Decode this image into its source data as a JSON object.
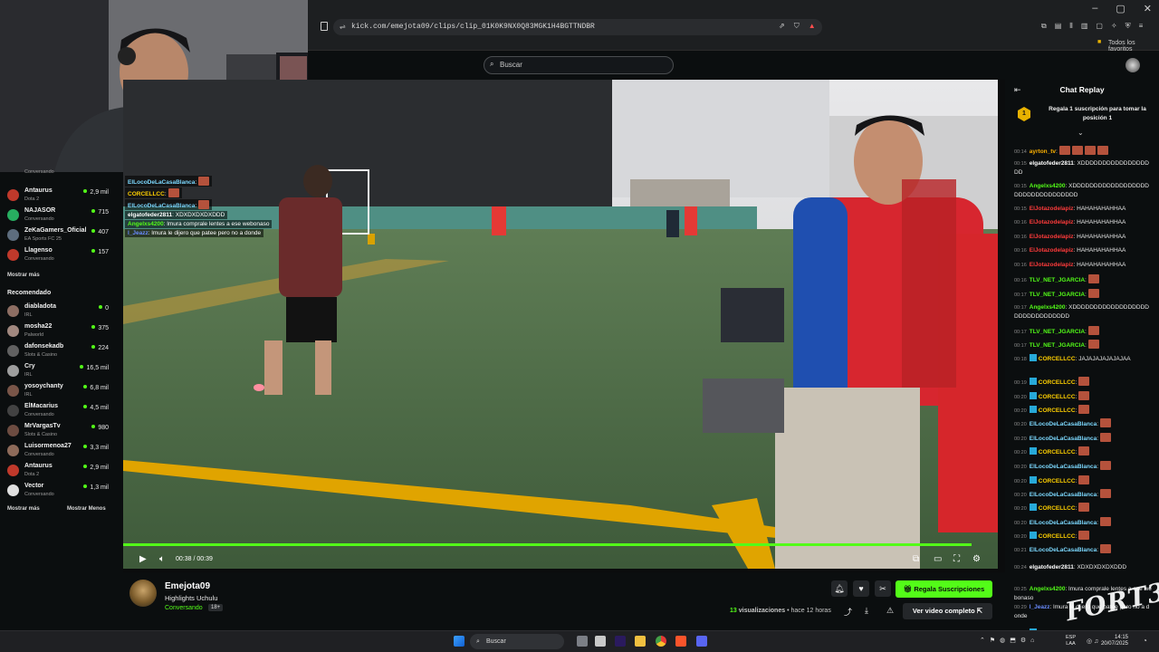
{
  "browser": {
    "url": "kick.com/emejota09/clips/clip_01K0K9NX0Q83MGK1H4BGTTNDBR",
    "bookmarks_label": "Todos los favoritos",
    "window_controls": [
      "–",
      "▢",
      "✕"
    ]
  },
  "topbar": {
    "search_placeholder": "Buscar"
  },
  "sidebar": {
    "followed": [
      {
        "name": "Antaurus",
        "category": "Dota 2",
        "viewers": "2,9 mil",
        "color": "#c0392b"
      },
      {
        "name": "NAJASOR",
        "category": "Conversando",
        "viewers": "715",
        "color": "#27ae60"
      },
      {
        "name": "ZeKaGamers_Oficial",
        "category": "EA Sports FC 25",
        "viewers": "407",
        "color": "#5d6d7e"
      },
      {
        "name": "Llagenso",
        "category": "Conversando",
        "viewers": "157",
        "color": "#c0392b"
      }
    ],
    "partial_top": {
      "name": "Luisormenoa27",
      "category": "Conversando",
      "viewers": "3,3 mil"
    },
    "show_more": "Mostrar más",
    "recommended_heading": "Recomendado",
    "recommended": [
      {
        "name": "diabladota",
        "category": "IRL",
        "viewers": "0",
        "color": "#8d6e63"
      },
      {
        "name": "mosha22",
        "category": "Palworld",
        "viewers": "375",
        "color": "#a1887f"
      },
      {
        "name": "dafonsekadb",
        "category": "Slots & Casino",
        "viewers": "224",
        "color": "#616161"
      },
      {
        "name": "Cry",
        "category": "IRL",
        "viewers": "16,5 mil",
        "color": "#9e9e9e"
      },
      {
        "name": "yosoychanty",
        "category": "IRL",
        "viewers": "6,8 mil",
        "color": "#795548"
      },
      {
        "name": "ElMacarius",
        "category": "Conversando",
        "viewers": "4,5 mil",
        "color": "#424242"
      },
      {
        "name": "MrVargasTv",
        "category": "Slots & Casino",
        "viewers": "980",
        "color": "#6d4c41"
      },
      {
        "name": "Luisormenoa27",
        "category": "Conversando",
        "viewers": "3,3 mil",
        "color": "#8e6b5a"
      },
      {
        "name": "Antaurus",
        "category": "Dota 2",
        "viewers": "2,9 mil",
        "color": "#c0392b"
      },
      {
        "name": "Vector",
        "category": "Conversando",
        "viewers": "1,3 mil",
        "color": "#e0e0e0"
      }
    ],
    "show_more_2": "Mostrar más",
    "show_less": "Mostrar Menos"
  },
  "video_overlay_chat": [
    {
      "user": "ElLocoDeLaCasaBlanca",
      "text": ":",
      "color": "#7cd9ff"
    },
    {
      "user": "CORCELLCC",
      "text": ":",
      "color": "#ffd000"
    },
    {
      "user": "ElLocoDeLaCasaBlanca",
      "text": ":",
      "color": "#7cd9ff"
    },
    {
      "user": "elgatofeder2811",
      "text": ": XDXDXDXDXDDD",
      "color": "#ffffff"
    },
    {
      "user": "Angelxs4200",
      "text": ": lmura comprale lentes a ese webonaso",
      "color": "#53fc18"
    },
    {
      "user": "l_Jeazz",
      "text": ": lmura le dijero que patee pero no a donde",
      "color": "#6a8cff"
    }
  ],
  "player": {
    "time_current": "00:38",
    "time_total": "00:39",
    "progress": 0.97
  },
  "chat": {
    "title": "Chat Replay",
    "pinned": "Regala 1 suscripción para tomar la posición 1",
    "pinned_badge": "1",
    "messages": [
      {
        "t": "00:14",
        "user": "ayrton_tv",
        "text": ":",
        "color": "#ffb300",
        "emotes": 4
      },
      {
        "t": "00:15",
        "user": "elgatofeder2811",
        "text": ": XDDDDDDDDDDDDDDDDDD",
        "color": "#ffffff",
        "emotes": 0
      },
      {
        "t": "00:15",
        "user": "Angelxs4200",
        "text": ": XDDDDDDDDDDDDDDDDDDDDDDDDDDDDDDDDD",
        "color": "#53fc18",
        "emotes": 0
      },
      {
        "t": "00:15",
        "user": "ElJotazodelapiz",
        "text": ": HAHAHAHAHHAA",
        "color": "#ff3b3b",
        "emotes": 0
      },
      {
        "t": "00:16",
        "user": "ElJotazodelapiz",
        "text": ": HAHAHAHAHHAA",
        "color": "#ff3b3b",
        "emotes": 0
      },
      {
        "t": "00:16",
        "user": "ElJotazodelapiz",
        "text": ": HAHAHAHAHHAA",
        "color": "#ff3b3b",
        "emotes": 0
      },
      {
        "t": "00:16",
        "user": "ElJotazodelapiz",
        "text": ": HAHAHAHAHHAA",
        "color": "#ff3b3b",
        "emotes": 0
      },
      {
        "t": "00:16",
        "user": "ElJotazodelapiz",
        "text": ": HAHAHAHAHHAA",
        "color": "#ff3b3b",
        "emotes": 0
      },
      {
        "t": "00:16",
        "user": "TLV_NET_JGARCIA",
        "text": ":",
        "color": "#53fc18",
        "emotes": 1
      },
      {
        "t": "00:17",
        "user": "TLV_NET_JGARCIA",
        "text": ":",
        "color": "#53fc18",
        "emotes": 1
      },
      {
        "t": "00:17",
        "user": "Angelxs4200",
        "text": ": XDDDDDDDDDDDDDDDDDDDDDDDDDDDDDDD",
        "color": "#53fc18",
        "emotes": 0
      },
      {
        "t": "00:17",
        "user": "TLV_NET_JGARCIA",
        "text": ":",
        "color": "#53fc18",
        "emotes": 1
      },
      {
        "t": "00:17",
        "user": "TLV_NET_JGARCIA",
        "text": ":",
        "color": "#53fc18",
        "emotes": 1
      },
      {
        "t": "00:18",
        "user": "CORCELLCC",
        "text": ": JAJAJAJAJAJAJAA",
        "color": "#ffd000",
        "emotes": 0,
        "badges": true
      },
      {
        "t": "00:19",
        "user": "CORCELLCC",
        "text": ":",
        "color": "#ffd000",
        "emotes": 1,
        "badges": true
      },
      {
        "t": "00:20",
        "user": "CORCELLCC",
        "text": ":",
        "color": "#ffd000",
        "emotes": 1,
        "badges": true
      },
      {
        "t": "00:20",
        "user": "CORCELLCC",
        "text": ":",
        "color": "#ffd000",
        "emotes": 1,
        "badges": true
      },
      {
        "t": "00:20",
        "user": "ElLocoDeLaCasaBlanca",
        "text": ":",
        "color": "#7cd9ff",
        "emotes": 1
      },
      {
        "t": "00:20",
        "user": "ElLocoDeLaCasaBlanca",
        "text": ":",
        "color": "#7cd9ff",
        "emotes": 1
      },
      {
        "t": "00:20",
        "user": "CORCELLCC",
        "text": ":",
        "color": "#ffd000",
        "emotes": 1,
        "badges": true
      },
      {
        "t": "00:20",
        "user": "ElLocoDeLaCasaBlanca",
        "text": ":",
        "color": "#7cd9ff",
        "emotes": 1
      },
      {
        "t": "00:20",
        "user": "CORCELLCC",
        "text": ":",
        "color": "#ffd000",
        "emotes": 1,
        "badges": true
      },
      {
        "t": "00:20",
        "user": "ElLocoDeLaCasaBlanca",
        "text": ":",
        "color": "#7cd9ff",
        "emotes": 1
      },
      {
        "t": "00:20",
        "user": "CORCELLCC",
        "text": ":",
        "color": "#ffd000",
        "emotes": 1,
        "badges": true
      },
      {
        "t": "00:20",
        "user": "ElLocoDeLaCasaBlanca",
        "text": ":",
        "color": "#7cd9ff",
        "emotes": 1
      },
      {
        "t": "00:20",
        "user": "CORCELLCC",
        "text": ":",
        "color": "#ffd000",
        "emotes": 1,
        "badges": true
      },
      {
        "t": "00:21",
        "user": "ElLocoDeLaCasaBlanca",
        "text": ":",
        "color": "#7cd9ff",
        "emotes": 1
      },
      {
        "t": "00:24",
        "user": "elgatofeder2811",
        "text": ": XDXDXDXDXDDD",
        "color": "#ffffff",
        "emotes": 0
      },
      {
        "t": "00:25",
        "user": "Angelxs4200",
        "text": ": lmura comprale lentes a ese webonaso",
        "color": "#53fc18",
        "emotes": 0
      },
      {
        "t": "00:29",
        "user": "l_Jeazz",
        "text": ": lmura le dijero que patee pero no a donde",
        "color": "#6a8cff",
        "emotes": 0
      },
      {
        "t": "00:37",
        "user": "AlejandroJimenez",
        "text": ":",
        "color": "#53fc18",
        "emotes": 0,
        "badges": true
      },
      {
        "t": "00:37",
        "user": "AlejandroJimenez",
        "text": ":",
        "color": "#53fc18",
        "emotes": 0,
        "badges": true
      }
    ]
  },
  "channel": {
    "name": "Emejota09",
    "clip_title": "Highlights Uchulu",
    "category": "Conversando",
    "age": "18+",
    "subscribe": "Regala Suscripciones",
    "views_count": "13",
    "views_label": "visualizaciones",
    "time_ago": "• hace 12 horas",
    "full_video": "Ver video completo"
  },
  "taskbar": {
    "search": "Buscar",
    "lang1": "ESP",
    "lang2": "LAA",
    "time": "14:15",
    "date": "20/07/2025"
  },
  "watermark": "FORT3",
  "colors": {
    "accent": "#53fc18",
    "bg": "#0b0e0f"
  }
}
